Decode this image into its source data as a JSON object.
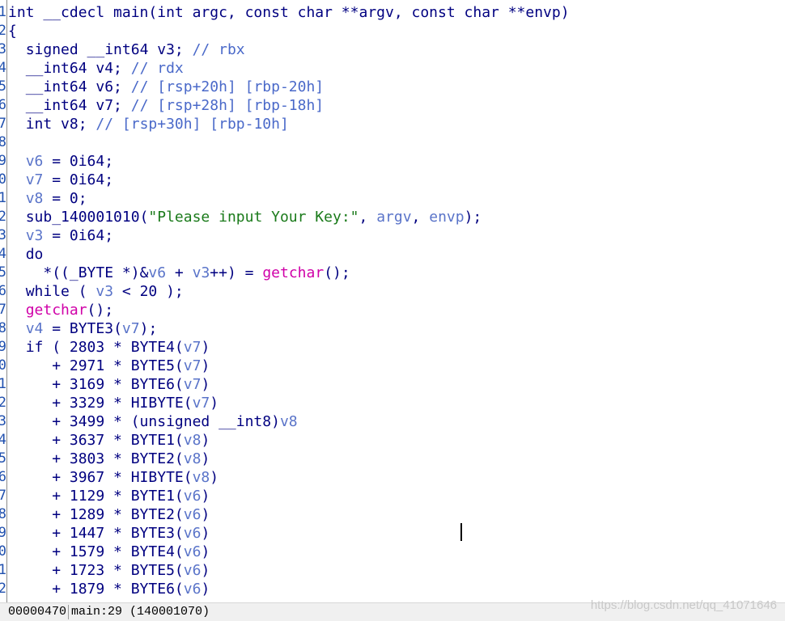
{
  "editor": {
    "line_numbers": [
      "1",
      "2",
      "3",
      "4",
      "5",
      "6",
      "7",
      "8",
      "9",
      "0",
      "1",
      "2",
      "3",
      "4",
      "5",
      "6",
      "7",
      "8",
      "9",
      "0",
      "1",
      "2",
      "3",
      "4",
      "5",
      "6",
      "7",
      "8",
      "9",
      "0",
      "1",
      "2"
    ],
    "lines": [
      {
        "indent": "",
        "tokens": [
          {
            "t": "int __cdecl main(int argc, const char **argv, const char **envp)",
            "c": "plain"
          }
        ]
      },
      {
        "indent": "",
        "tokens": [
          {
            "t": "{",
            "c": "plain"
          }
        ]
      },
      {
        "indent": "  ",
        "tokens": [
          {
            "t": "signed __int64 v3; ",
            "c": "plain"
          },
          {
            "t": "// rbx",
            "c": "com"
          }
        ]
      },
      {
        "indent": "  ",
        "tokens": [
          {
            "t": "__int64 v4; ",
            "c": "plain"
          },
          {
            "t": "// rdx",
            "c": "com"
          }
        ]
      },
      {
        "indent": "  ",
        "tokens": [
          {
            "t": "__int64 v6; ",
            "c": "plain"
          },
          {
            "t": "// [rsp+20h] [rbp-20h]",
            "c": "com"
          }
        ]
      },
      {
        "indent": "  ",
        "tokens": [
          {
            "t": "__int64 v7; ",
            "c": "plain"
          },
          {
            "t": "// [rsp+28h] [rbp-18h]",
            "c": "com"
          }
        ]
      },
      {
        "indent": "  ",
        "tokens": [
          {
            "t": "int v8; ",
            "c": "plain"
          },
          {
            "t": "// [rsp+30h] [rbp-10h]",
            "c": "com"
          }
        ]
      },
      {
        "indent": "",
        "tokens": []
      },
      {
        "indent": "  ",
        "tokens": [
          {
            "t": "v6",
            "c": "var"
          },
          {
            "t": " = 0i64;",
            "c": "plain"
          }
        ]
      },
      {
        "indent": "  ",
        "tokens": [
          {
            "t": "v7",
            "c": "var"
          },
          {
            "t": " = 0i64;",
            "c": "plain"
          }
        ]
      },
      {
        "indent": "  ",
        "tokens": [
          {
            "t": "v8",
            "c": "var"
          },
          {
            "t": " = 0;",
            "c": "plain"
          }
        ]
      },
      {
        "indent": "  ",
        "tokens": [
          {
            "t": "sub_140001010(",
            "c": "plain"
          },
          {
            "t": "\"Please input Your Key:\"",
            "c": "str"
          },
          {
            "t": ", ",
            "c": "plain"
          },
          {
            "t": "argv",
            "c": "var"
          },
          {
            "t": ", ",
            "c": "plain"
          },
          {
            "t": "envp",
            "c": "var"
          },
          {
            "t": ");",
            "c": "plain"
          }
        ]
      },
      {
        "indent": "  ",
        "tokens": [
          {
            "t": "v3",
            "c": "var"
          },
          {
            "t": " = 0i64;",
            "c": "plain"
          }
        ]
      },
      {
        "indent": "  ",
        "tokens": [
          {
            "t": "do",
            "c": "plain"
          }
        ]
      },
      {
        "indent": "    ",
        "tokens": [
          {
            "t": "*((_BYTE *)&",
            "c": "plain"
          },
          {
            "t": "v6",
            "c": "var"
          },
          {
            "t": " + ",
            "c": "plain"
          },
          {
            "t": "v3",
            "c": "var"
          },
          {
            "t": "++) = ",
            "c": "plain"
          },
          {
            "t": "getchar",
            "c": "call"
          },
          {
            "t": "();",
            "c": "plain"
          }
        ]
      },
      {
        "indent": "  ",
        "tokens": [
          {
            "t": "while ( ",
            "c": "plain"
          },
          {
            "t": "v3",
            "c": "var"
          },
          {
            "t": " < 20 );",
            "c": "plain"
          }
        ]
      },
      {
        "indent": "  ",
        "tokens": [
          {
            "t": "getchar",
            "c": "call"
          },
          {
            "t": "();",
            "c": "plain"
          }
        ]
      },
      {
        "indent": "  ",
        "tokens": [
          {
            "t": "v4",
            "c": "var"
          },
          {
            "t": " = BYTE3(",
            "c": "plain"
          },
          {
            "t": "v7",
            "c": "var"
          },
          {
            "t": ");",
            "c": "plain"
          }
        ]
      },
      {
        "indent": "  ",
        "tokens": [
          {
            "t": "if ( 2803 * BYTE4(",
            "c": "plain"
          },
          {
            "t": "v7",
            "c": "var"
          },
          {
            "t": ")",
            "c": "plain"
          }
        ]
      },
      {
        "indent": "     ",
        "tokens": [
          {
            "t": "+ 2971 * BYTE5(",
            "c": "plain"
          },
          {
            "t": "v7",
            "c": "var"
          },
          {
            "t": ")",
            "c": "plain"
          }
        ]
      },
      {
        "indent": "     ",
        "tokens": [
          {
            "t": "+ 3169 * BYTE6(",
            "c": "plain"
          },
          {
            "t": "v7",
            "c": "var"
          },
          {
            "t": ")",
            "c": "plain"
          }
        ]
      },
      {
        "indent": "     ",
        "tokens": [
          {
            "t": "+ 3329 * HIBYTE(",
            "c": "plain"
          },
          {
            "t": "v7",
            "c": "var"
          },
          {
            "t": ")",
            "c": "plain"
          }
        ]
      },
      {
        "indent": "     ",
        "tokens": [
          {
            "t": "+ 3499 * (unsigned __int8)",
            "c": "plain"
          },
          {
            "t": "v8",
            "c": "var"
          }
        ]
      },
      {
        "indent": "     ",
        "tokens": [
          {
            "t": "+ 3637 * BYTE1(",
            "c": "plain"
          },
          {
            "t": "v8",
            "c": "var"
          },
          {
            "t": ")",
            "c": "plain"
          }
        ]
      },
      {
        "indent": "     ",
        "tokens": [
          {
            "t": "+ 3803 * BYTE2(",
            "c": "plain"
          },
          {
            "t": "v8",
            "c": "var"
          },
          {
            "t": ")",
            "c": "plain"
          }
        ]
      },
      {
        "indent": "     ",
        "tokens": [
          {
            "t": "+ 3967 * HIBYTE(",
            "c": "plain"
          },
          {
            "t": "v8",
            "c": "var"
          },
          {
            "t": ")",
            "c": "plain"
          }
        ]
      },
      {
        "indent": "     ",
        "tokens": [
          {
            "t": "+ 1129 * BYTE1(",
            "c": "plain"
          },
          {
            "t": "v6",
            "c": "var"
          },
          {
            "t": ")",
            "c": "plain"
          }
        ]
      },
      {
        "indent": "     ",
        "tokens": [
          {
            "t": "+ 1289 * BYTE2(",
            "c": "plain"
          },
          {
            "t": "v6",
            "c": "var"
          },
          {
            "t": ")",
            "c": "plain"
          }
        ]
      },
      {
        "indent": "     ",
        "tokens": [
          {
            "t": "+ 1447 * BYTE3(",
            "c": "plain"
          },
          {
            "t": "v6",
            "c": "var"
          },
          {
            "t": ")",
            "c": "plain"
          }
        ]
      },
      {
        "indent": "     ",
        "tokens": [
          {
            "t": "+ 1579 * BYTE4(",
            "c": "plain"
          },
          {
            "t": "v6",
            "c": "var"
          },
          {
            "t": ")",
            "c": "plain"
          }
        ]
      },
      {
        "indent": "     ",
        "tokens": [
          {
            "t": "+ 1723 * BYTE5(",
            "c": "plain"
          },
          {
            "t": "v6",
            "c": "var"
          },
          {
            "t": ")",
            "c": "plain"
          }
        ]
      },
      {
        "indent": "     ",
        "tokens": [
          {
            "t": "+ 1879 * BYTE6(",
            "c": "plain"
          },
          {
            "t": "v6",
            "c": "var"
          },
          {
            "t": ")",
            "c": "plain"
          }
        ]
      }
    ]
  },
  "status": {
    "address": "00000470",
    "location": "main:29 (140001070)"
  },
  "watermark": "https://blog.csdn.net/qq_41071646",
  "colors": {
    "keyword": "#000080",
    "variable": "#5a74c9",
    "comment": "#4a69c9",
    "string": "#1a7a1a",
    "import_call": "#d000a8"
  }
}
